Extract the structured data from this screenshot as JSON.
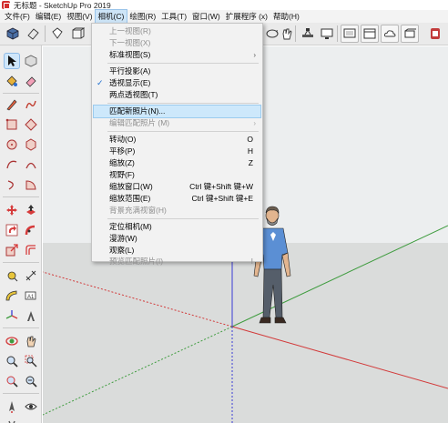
{
  "window": {
    "title": "无标题 - SketchUp Pro 2019"
  },
  "menubar": {
    "items": [
      {
        "label": "文件(F)"
      },
      {
        "label": "编辑(E)"
      },
      {
        "label": "视图(V)"
      },
      {
        "label": "相机(C)"
      },
      {
        "label": "绘图(R)"
      },
      {
        "label": "工具(T)"
      },
      {
        "label": "窗口(W)"
      },
      {
        "label": "扩展程序 (x)"
      },
      {
        "label": "帮助(H)"
      }
    ],
    "active_index": 3
  },
  "camera_menu": {
    "items": [
      {
        "label": "上一视图(R)",
        "disabled": true
      },
      {
        "label": "下一视图(X)",
        "disabled": true
      },
      {
        "label": "标准视图(S)",
        "submenu": true
      },
      {
        "label": "平行投影(A)"
      },
      {
        "label": "透视显示(E)",
        "checked": true
      },
      {
        "label": "两点透视图(T)"
      },
      {
        "label": "匹配新照片(N)...",
        "highlighted": true
      },
      {
        "label": "编辑匹配照片 (M)",
        "disabled": true,
        "submenu": true
      },
      {
        "label": "转动(O)",
        "shortcut": "O"
      },
      {
        "label": "平移(P)",
        "shortcut": "H"
      },
      {
        "label": "缩放(Z)",
        "shortcut": "Z"
      },
      {
        "label": "视野(F)"
      },
      {
        "label": "缩放窗口(W)",
        "shortcut": "Ctrl 键+Shift 键+W"
      },
      {
        "label": "缩放范围(E)",
        "shortcut": "Ctrl 键+Shift 键+E"
      },
      {
        "label": "背景充满视窗(H)",
        "disabled": true
      },
      {
        "label": "定位相机(M)"
      },
      {
        "label": "漫游(W)"
      },
      {
        "label": "观察(L)"
      },
      {
        "label": "预览匹配照片(I)",
        "disabled": true,
        "shortcut": "I"
      }
    ],
    "check_glyph": "✓",
    "submenu_glyph": "›"
  },
  "icons": {
    "toolbar_top": [
      "cube-icon",
      "eraser-icon",
      "paint-bucket-icon",
      "orbit-icon",
      "pan-hand-icon",
      "camera-pan-icon",
      "display-icon",
      "presentation-icon",
      "cloud-icon",
      "components-icon",
      "extension-warehouse-icon"
    ],
    "toolbar_left": [
      "select-arrow-icon",
      "make-component-icon",
      "paint-bucket-icon",
      "eraser-icon",
      "pencil-line-icon",
      "freehand-icon",
      "rectangle-icon",
      "rotated-rectangle-icon",
      "circle-icon",
      "polygon-icon",
      "arc-icon",
      "two-point-arc-icon",
      "three-point-arc-icon",
      "pie-icon",
      "move-icon",
      "push-pull-icon",
      "rotate-icon",
      "follow-me-icon",
      "scale-icon",
      "offset-icon",
      "tape-measure-icon",
      "dimension-icon",
      "protractor-icon",
      "text-icon",
      "axes-icon",
      "3d-text-icon",
      "orbit-icon",
      "pan-icon",
      "zoom-icon",
      "zoom-window-icon",
      "zoom-extents-icon",
      "position-camera-icon",
      "walk-icon",
      "look-around-icon"
    ]
  },
  "colors": {
    "axis_red": "#d23a3a",
    "axis_green": "#3f9c3f",
    "axis_blue": "#3b3bd6",
    "menu_highlight": "#cde8fb",
    "sky": "#eceeef",
    "ground": "#dadcdb"
  }
}
